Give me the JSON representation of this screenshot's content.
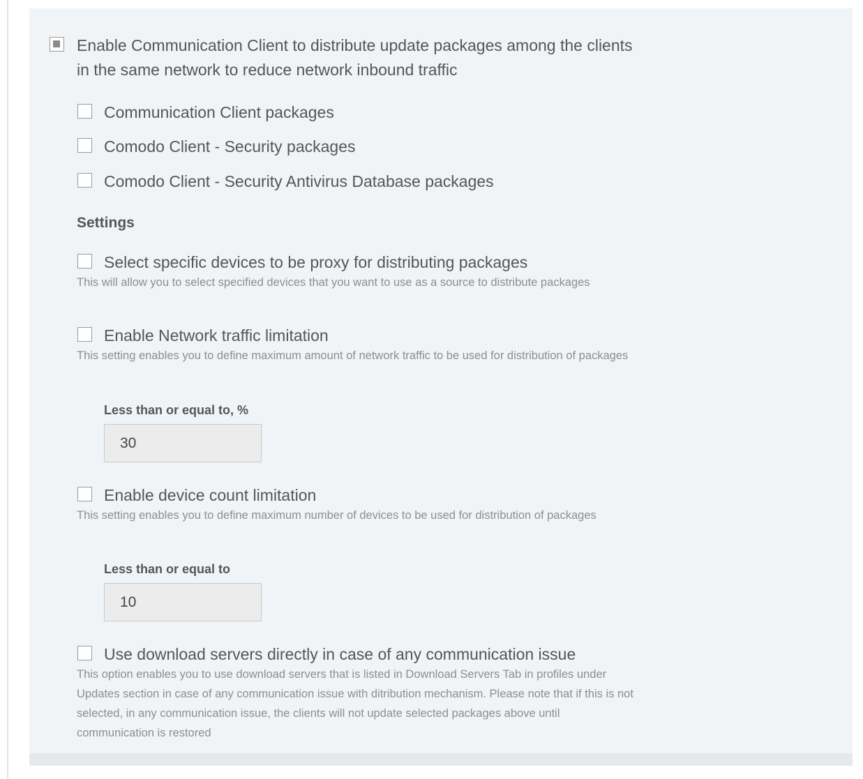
{
  "main_option": {
    "label": "Enable Communication Client to distribute update packages among the clients in the same network to reduce network inbound traffic",
    "state": "partial"
  },
  "packages": [
    {
      "label": "Communication Client packages",
      "checked": false
    },
    {
      "label": "Comodo Client - Security packages",
      "checked": false
    },
    {
      "label": "Comodo Client - Security Antivirus Database packages",
      "checked": false
    }
  ],
  "settings": {
    "heading": "Settings",
    "proxy": {
      "label": "Select specific devices to be proxy for distributing packages",
      "description": "This will allow you to select specified devices that you want to use as a source to distribute packages",
      "checked": false
    },
    "network_limit": {
      "label": "Enable Network traffic limitation",
      "description": "This setting enables you to define maximum amount of network traffic to be used for distribution of packages",
      "checked": false,
      "field_label": "Less than or equal to, %",
      "value": "30"
    },
    "device_limit": {
      "label": "Enable device count limitation",
      "description": "This setting enables you to define maximum number of devices to be used for distribution of packages",
      "checked": false,
      "field_label": "Less than or equal to",
      "value": "10"
    },
    "download_servers": {
      "label": "Use download servers directly in case of any communication issue",
      "description": "This option enables you to use download servers that is listed in Download Servers Tab in profiles under Updates section in case of any communication issue with ditribution mechanism. Please note that if this is not selected, in any communication issue, the clients will not update selected packages above until communication is restored",
      "checked": false
    }
  },
  "colors": {
    "panel_bg": "#f1f4f6",
    "text": "#555555",
    "description_text": "#8a8f94",
    "input_bg": "#ececec"
  }
}
